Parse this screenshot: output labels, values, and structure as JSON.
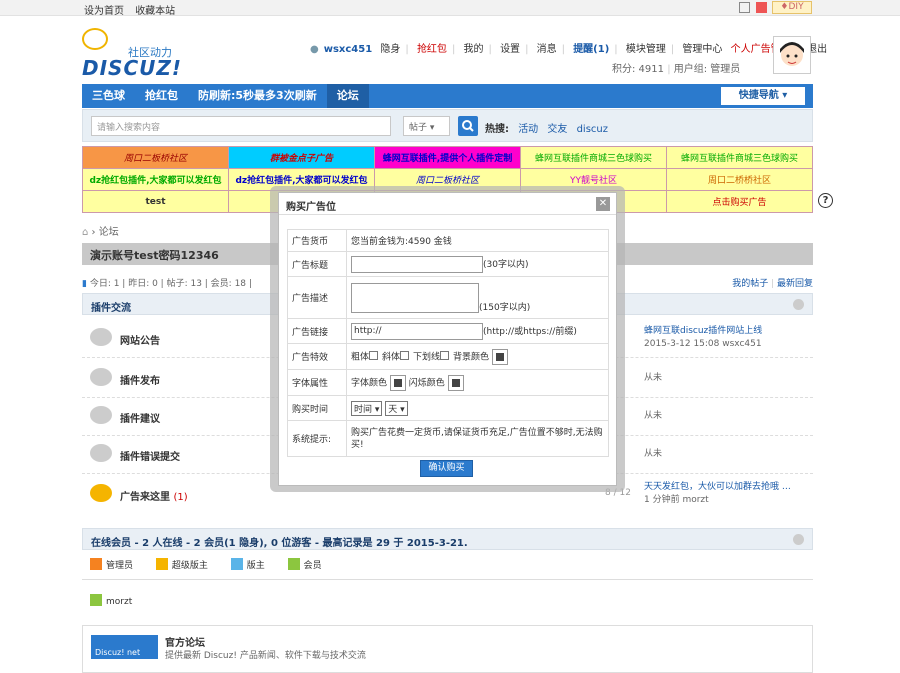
{
  "topbar": {
    "set_home": "设为首页",
    "bookmark": "收藏本站",
    "diy": "♦DIY"
  },
  "logo": {
    "sub": "社区动力",
    "name": "DISCUZ!"
  },
  "user": {
    "name": "wsxc451",
    "hide": "隐身",
    "red_packet": "抢红包",
    "mine": "我的",
    "settings": "设置",
    "messages": "消息",
    "remind": "提醒(1)",
    "module": "模块管理",
    "admin": "管理中心",
    "ad_manage": "个人广告管理",
    "logout": "退出",
    "points": "积分: 4911",
    "group": "用户组: 管理员"
  },
  "nav": {
    "items": [
      "三色球",
      "抢红包",
      "防刷新:5秒最多3次刷新",
      "论坛"
    ],
    "quick": "快捷导航"
  },
  "search": {
    "placeholder": "请输入搜索内容",
    "type": "帖子",
    "hot_label": "热搜:",
    "hot": [
      "活动",
      "交友",
      "discuz"
    ]
  },
  "ads": [
    [
      "周口二板桥社区",
      "群被金点子广告",
      "蜂网互联插件,提供个人插件定制",
      "蜂网互联插件商城三色球购买",
      "蜂网互联插件商城三色球购买"
    ],
    [
      "dz抢红包插件,大家都可以发红包",
      "dz抢红包插件,大家都可以发红包",
      "周口二板桥社区",
      "YY靓号社区",
      "周口二桥桥社区"
    ],
    [
      "test",
      "",
      "",
      "",
      "点击购买广告"
    ]
  ],
  "breadcrumb": "论坛",
  "announcement": "演示账号test密码12346",
  "stats": {
    "text": "今日: 1 | 昨日: 0 | 帖子: 13 | 会员: 18 |",
    "mine": "我的帖子",
    "latest": "最新回复"
  },
  "section_plugins": "插件交流",
  "forums": [
    {
      "name": "网站公告",
      "count": "/ 1",
      "last1": "蜂网互联discuz插件网站上线",
      "last2": "2015-3-12 15:08 wsxc451"
    },
    {
      "name": "插件发布",
      "count": "/ 0",
      "last1": "从未",
      "last2": ""
    },
    {
      "name": "插件建议",
      "count": "/ 0",
      "last1": "从未",
      "last2": ""
    },
    {
      "name": "插件错误提交",
      "count": "/ 0",
      "last1": "从未",
      "last2": ""
    },
    {
      "name": "广告来这里",
      "badge": "(1)",
      "count": "8 / 12",
      "last1": "天天发红包，大伙可以加群去抢哦 …",
      "last2": "1 分钟前 morzt"
    }
  ],
  "online": "在线会员 - 2 人在线 - 2 会员(1 隐身), 0 位游客 - 最高记录是 29 于 2015-3-21.",
  "legend": [
    "管理员",
    "超级版主",
    "版主",
    "会员"
  ],
  "member": "morzt",
  "official": {
    "logo": "Discuz! net",
    "title": "官方论坛",
    "desc": "提供最新 Discuz! 产品新闻、软件下载与技术交流"
  },
  "dialog": {
    "title": "购买广告位",
    "close": "✕",
    "currency_label": "广告货币",
    "currency_value": "您当前金钱为:4590 金钱",
    "title_label": "广告标题",
    "title_hint": "(30字以内)",
    "desc_label": "广告描述",
    "desc_hint": "(150字以内)",
    "link_label": "广告链接",
    "link_value": "http://",
    "link_hint": "(http://或https://前缀)",
    "effect_label": "广告特效",
    "effects": [
      "粗体",
      "斜体",
      "下划线",
      "背景颜色"
    ],
    "font_label": "字体属性",
    "font_color": "字体颜色",
    "flash_color": "闪烁颜色",
    "time_label": "购买时间",
    "time_unit": "时间",
    "day_unit": "天",
    "tip_label": "系统提示:",
    "tip": "购买广告花费一定货币,请保证货币充足,广告位置不够时,无法购买!",
    "submit": "确认购买"
  },
  "colors": {
    "nav": "#2b7acd",
    "accent": "#c00"
  }
}
